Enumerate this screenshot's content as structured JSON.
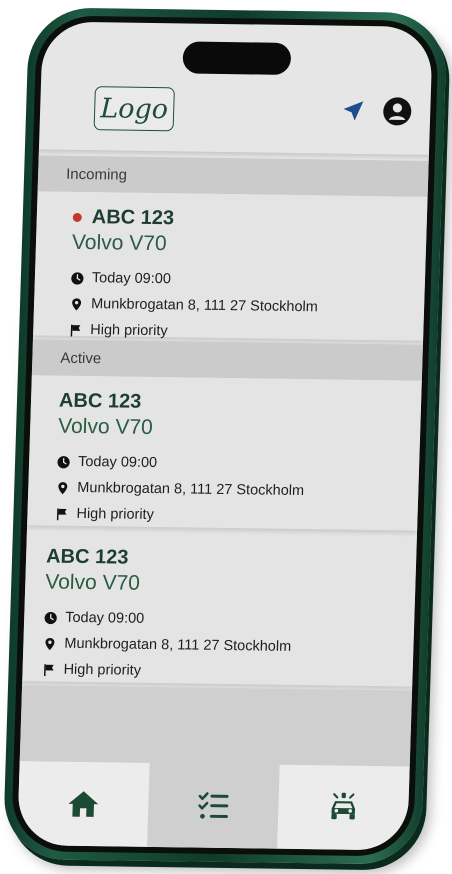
{
  "header": {
    "logo_text": "Logo",
    "icons": [
      "navigation-arrow-icon",
      "account-icon"
    ]
  },
  "sections": [
    {
      "title": "Incoming",
      "cards": [
        {
          "plate": "ABC 123",
          "model": "Volvo V70",
          "time": "Today 09:00",
          "address": "Munkbrogatan 8, 111 27 Stockholm",
          "priority": "High priority",
          "status_dot": "#c0392b"
        }
      ]
    },
    {
      "title": "Active",
      "cards": [
        {
          "plate": "ABC 123",
          "model": "Volvo V70",
          "time": "Today 09:00",
          "address": "Munkbrogatan 8, 111 27 Stockholm",
          "priority": "High priority"
        },
        {
          "plate": "ABC 123",
          "model": "Volvo V70",
          "time": "Today 09:00",
          "address": "Munkbrogatan 8, 111 27 Stockholm",
          "priority": "High priority"
        }
      ]
    }
  ],
  "tabbar": {
    "tabs": [
      {
        "icon": "home-icon",
        "active": false
      },
      {
        "icon": "task-list-icon",
        "active": true
      },
      {
        "icon": "emergency-car-icon",
        "active": false
      }
    ]
  },
  "colors": {
    "brand_green": "#1d3d2f",
    "accent_green": "#2a5c44",
    "alert_red": "#c0392b",
    "frame_green": "#1f5a43",
    "nav_blue": "#1f4c8f"
  }
}
